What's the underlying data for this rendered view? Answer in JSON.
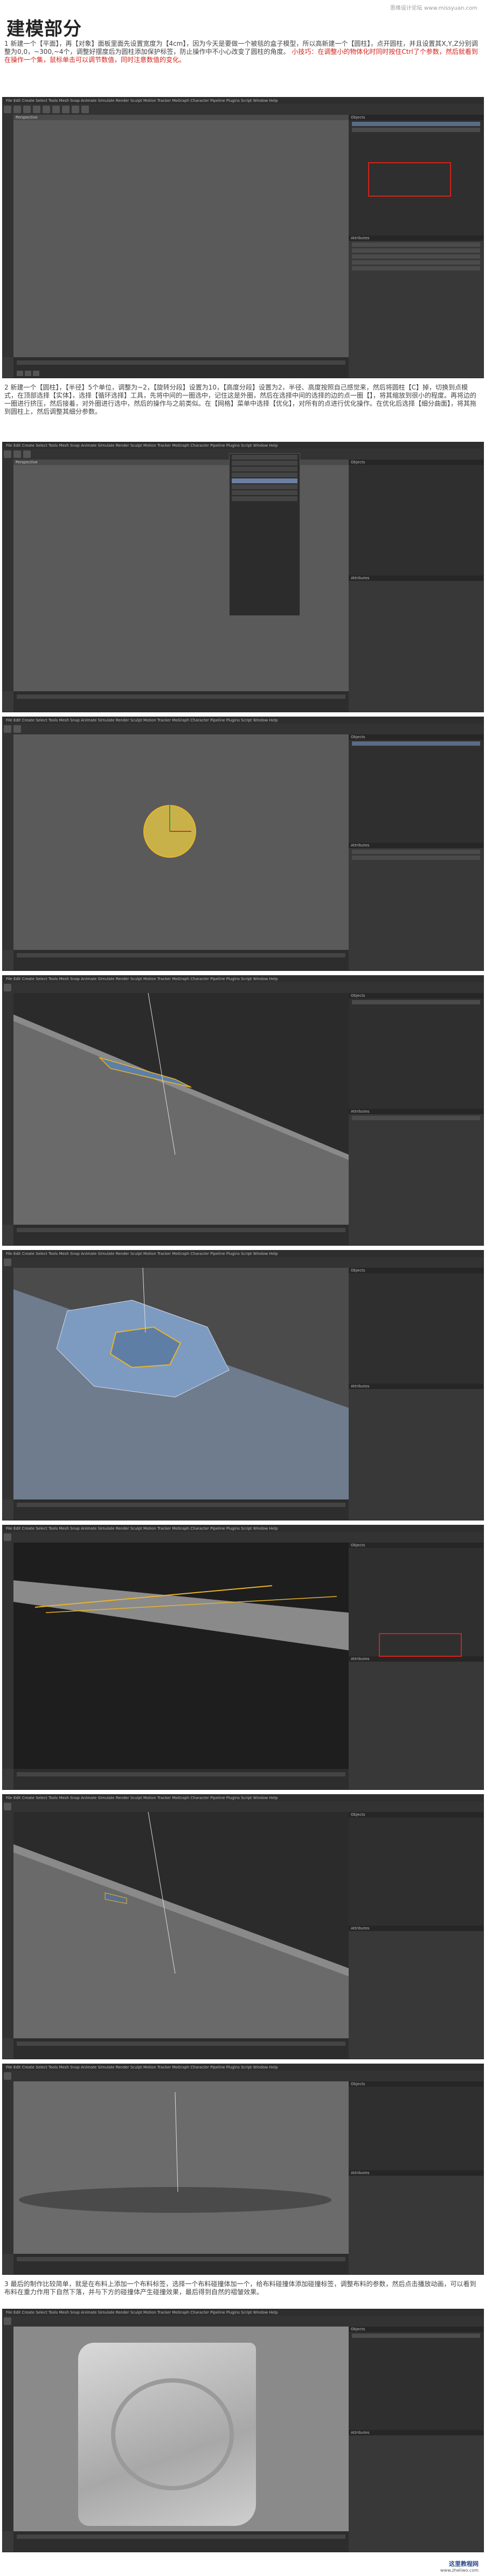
{
  "page": {
    "watermark_top": "思缘设计论坛 www.missyuan.com",
    "heading": "建模部分"
  },
  "paragraphs": {
    "p1_a": "1 新建一个【平面】，再【对象】面板里面先设置宽度为【4cm】，因为今天是要做一个被毯的盒子模型，所以高新建一个【圆柱】，点开圆柱，并且设置其X,Y,Z分别调整为0,0，~300,~4个，调整好摆度后为圆柱添加保护标签，防止操作中不小心改变了圆柱的角度。",
    "p1_red": "小技巧：在调整小的物体化时同时按住Ctrl了个参数，然后就看到在操作一个集，鼠标单击可以调节数值，同时注意数值的变化。"
  },
  "app": {
    "menu_text": "File Edit Create Select Tools Mesh Snap Animate Simulate Render Sculpt Motion Tracker MoGraph Character Pipeline Plugins Script Window Help",
    "viewport_label": "Perspective",
    "objects_label": "Objects",
    "attributes_label": "Attributes"
  },
  "paragraphs2": {
    "p2": "2 新建一个【圆柱】，【半径】5个单位，调整为~2，【旋转分段】设置为10，【高度分段】设置为2，半径、高度按照自己感觉来，然后将圆柱【C】掉，切换到点模式，在顶部选择【实体】，选择【循环选择】工具，先将中间的一圈选中，记住这是外圈，然后在选择中间的选择的边的点一圈【】，将其缩放到很小的程度。再将边的一圈进行挤压，然后接着，对外圈进行选中，然后的操作与之前类似。在【网格】菜单中选择【优化】，对所有的点进行优化操作。在优化后选择【细分曲面】，将其拖到圆柱上，然后调整其细分参数。",
    "p3": "3 最后的制作比较简单，就是在布料上添加一个布料标签，选择一个布料碰撞体加一个，给布料碰撞体添加碰撞标签，调整布料的参数，然后点击播放动画，可以看到布料在重力作用下自然下落，并与下方的碰撞体产生碰撞效果，最后得到自然的褶皱效果。"
  },
  "footer": {
    "logo": "这里教程网",
    "url": "www.zheliwo.com"
  },
  "colors": {
    "accent_red": "#d0241a",
    "ui_dark": "#333333",
    "viewport_gray": "#5a5a5a",
    "selection_yellow": "#e8b52a"
  }
}
